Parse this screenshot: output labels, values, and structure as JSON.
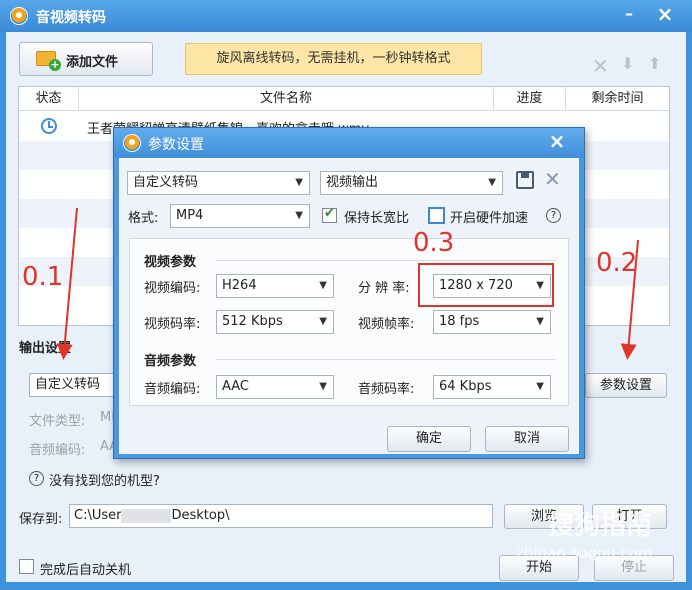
{
  "window": {
    "title": "音视频转码",
    "minimize": "–",
    "close": "×"
  },
  "toolbar": {
    "add_file": "添加文件",
    "banner": "旋风离线转码，无需挂机，一秒钟转格式"
  },
  "table": {
    "columns": [
      "状态",
      "文件名称",
      "进度",
      "剩余时间"
    ],
    "rows": [
      {
        "file": "王者荣耀貂蝉高清壁纸集锦，喜欢的拿走哦.wmv"
      }
    ]
  },
  "output": {
    "section": "输出设置",
    "preset": "自定义转码",
    "file_type_label": "文件类型:",
    "file_type_value": "MP",
    "audio_codec_label": "音频编码:",
    "audio_codec_value": "AA",
    "param_button": "参数设置",
    "help_link": "没有找到您的机型?",
    "save_label": "保存到:",
    "save_path_prefix": "C:\\User",
    "save_path_suffix": "Desktop\\",
    "browse": "浏览",
    "open": "打开"
  },
  "footer": {
    "auto_shutdown": "完成后自动关机",
    "start": "开始",
    "stop": "停止"
  },
  "dialog": {
    "title": "参数设置",
    "close": "×",
    "preset": "自定义转码",
    "output_type": "视频输出",
    "format_label": "格式:",
    "format": "MP4",
    "keep_ratio": "保持长宽比",
    "hw_accel": "开启硬件加速",
    "video_group": "视频参数",
    "video_codec_label": "视频编码:",
    "video_codec": "H264",
    "resolution_label": "分 辨 率:",
    "resolution": "1280 x 720",
    "video_bitrate_label": "视频码率:",
    "video_bitrate": "512 Kbps",
    "framerate_label": "视频帧率:",
    "framerate": "18 fps",
    "audio_group": "音频参数",
    "audio_codec_label": "音频编码:",
    "audio_codec": "AAC",
    "audio_bitrate_label": "音频码率:",
    "audio_bitrate": "64 Kbps",
    "ok": "确定",
    "cancel": "取消"
  },
  "annotations": {
    "a1": "0.1",
    "a2": "0.2",
    "a3": "0.3"
  },
  "watermark": {
    "text": "搜狗指南",
    "url": "zhinan.sogou.com"
  },
  "colors": {
    "titlebar": "#3f92dc",
    "annotation": "#e0342a",
    "banner": "#fde6a5"
  }
}
